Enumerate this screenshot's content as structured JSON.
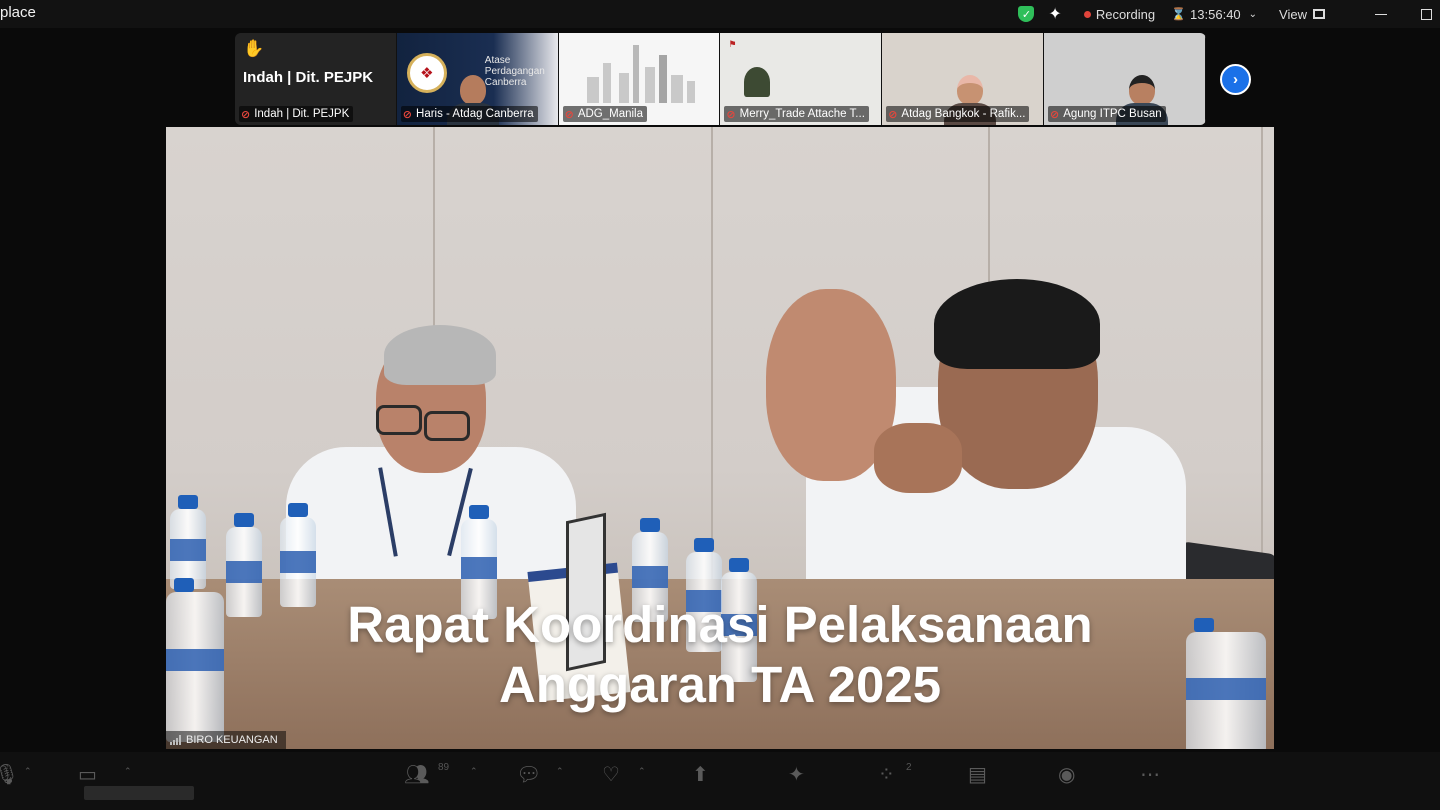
{
  "app": {
    "title": "place"
  },
  "topbar": {
    "recording_label": "Recording",
    "timer": "13:56:40",
    "view_label": "View"
  },
  "filmstrip": {
    "tiles": [
      {
        "name": "Indah | Dit. PEJPK",
        "display_name": "Indah | Dit. PEJPK",
        "raised_hand": true
      },
      {
        "name": "Haris - Atdag Canberra",
        "caption": [
          "Atase",
          "Perdagangan",
          "Canberra"
        ]
      },
      {
        "name": "ADG_Manila"
      },
      {
        "name": "Merry_Trade Attache T..."
      },
      {
        "name": "Atdag Bangkok - Rafik..."
      },
      {
        "name": "Agung ITPC Busan"
      }
    ]
  },
  "main": {
    "speaker_name": "BIRO KEUANGAN",
    "overlay_line1": "Rapat Koordinasi Pelaksanaan",
    "overlay_line2": "Anggaran TA 2025"
  },
  "toolbar": {
    "participants_count": "89",
    "apps_count": "2",
    "buttons": [
      {
        "id": "audio",
        "icon": "mic-icon"
      },
      {
        "id": "video",
        "icon": "camera-icon"
      },
      {
        "id": "participants",
        "icon": "people-icon"
      },
      {
        "id": "chat",
        "icon": "chat-icon"
      },
      {
        "id": "react",
        "icon": "heart-icon"
      },
      {
        "id": "share",
        "icon": "share-icon"
      },
      {
        "id": "ai",
        "icon": "sparkle-icon"
      },
      {
        "id": "apps",
        "icon": "apps-icon"
      },
      {
        "id": "notes",
        "icon": "notes-icon"
      },
      {
        "id": "record",
        "icon": "record-icon"
      },
      {
        "id": "more",
        "icon": "more-icon"
      }
    ]
  }
}
